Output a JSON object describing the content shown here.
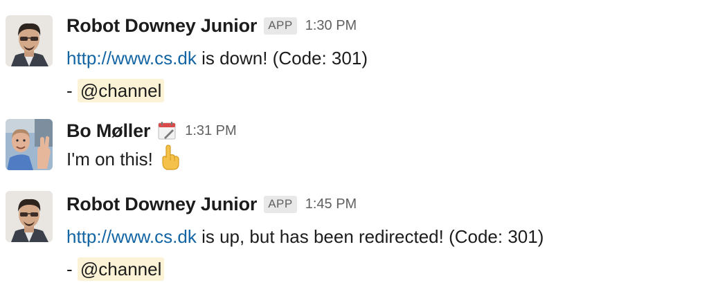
{
  "messages": [
    {
      "sender": "Robot Downey Junior",
      "badge": "APP",
      "time": "1:30 PM",
      "avatar_icon": "robot-downey-avatar",
      "link": "http://www.cs.dk",
      "text": " is down! (Code: 301)",
      "prefix": "- ",
      "mention": "@channel"
    },
    {
      "sender": "Bo Møller",
      "status_icon": "calendar-icon",
      "time": "1:31 PM",
      "avatar_icon": "bo-moller-avatar",
      "text": "I'm on this!",
      "emoji": "point-up-emoji"
    },
    {
      "sender": "Robot Downey Junior",
      "badge": "APP",
      "time": "1:45 PM",
      "avatar_icon": "robot-downey-avatar",
      "link": "http://www.cs.dk",
      "text": " is up, but has been redirected! (Code: 301)",
      "prefix": "- ",
      "mention": "@channel"
    }
  ],
  "colors": {
    "link": "#1264a3",
    "mention_bg": "#fcf3d6",
    "badge_bg": "#e8e8e8",
    "timestamp": "#616061"
  }
}
